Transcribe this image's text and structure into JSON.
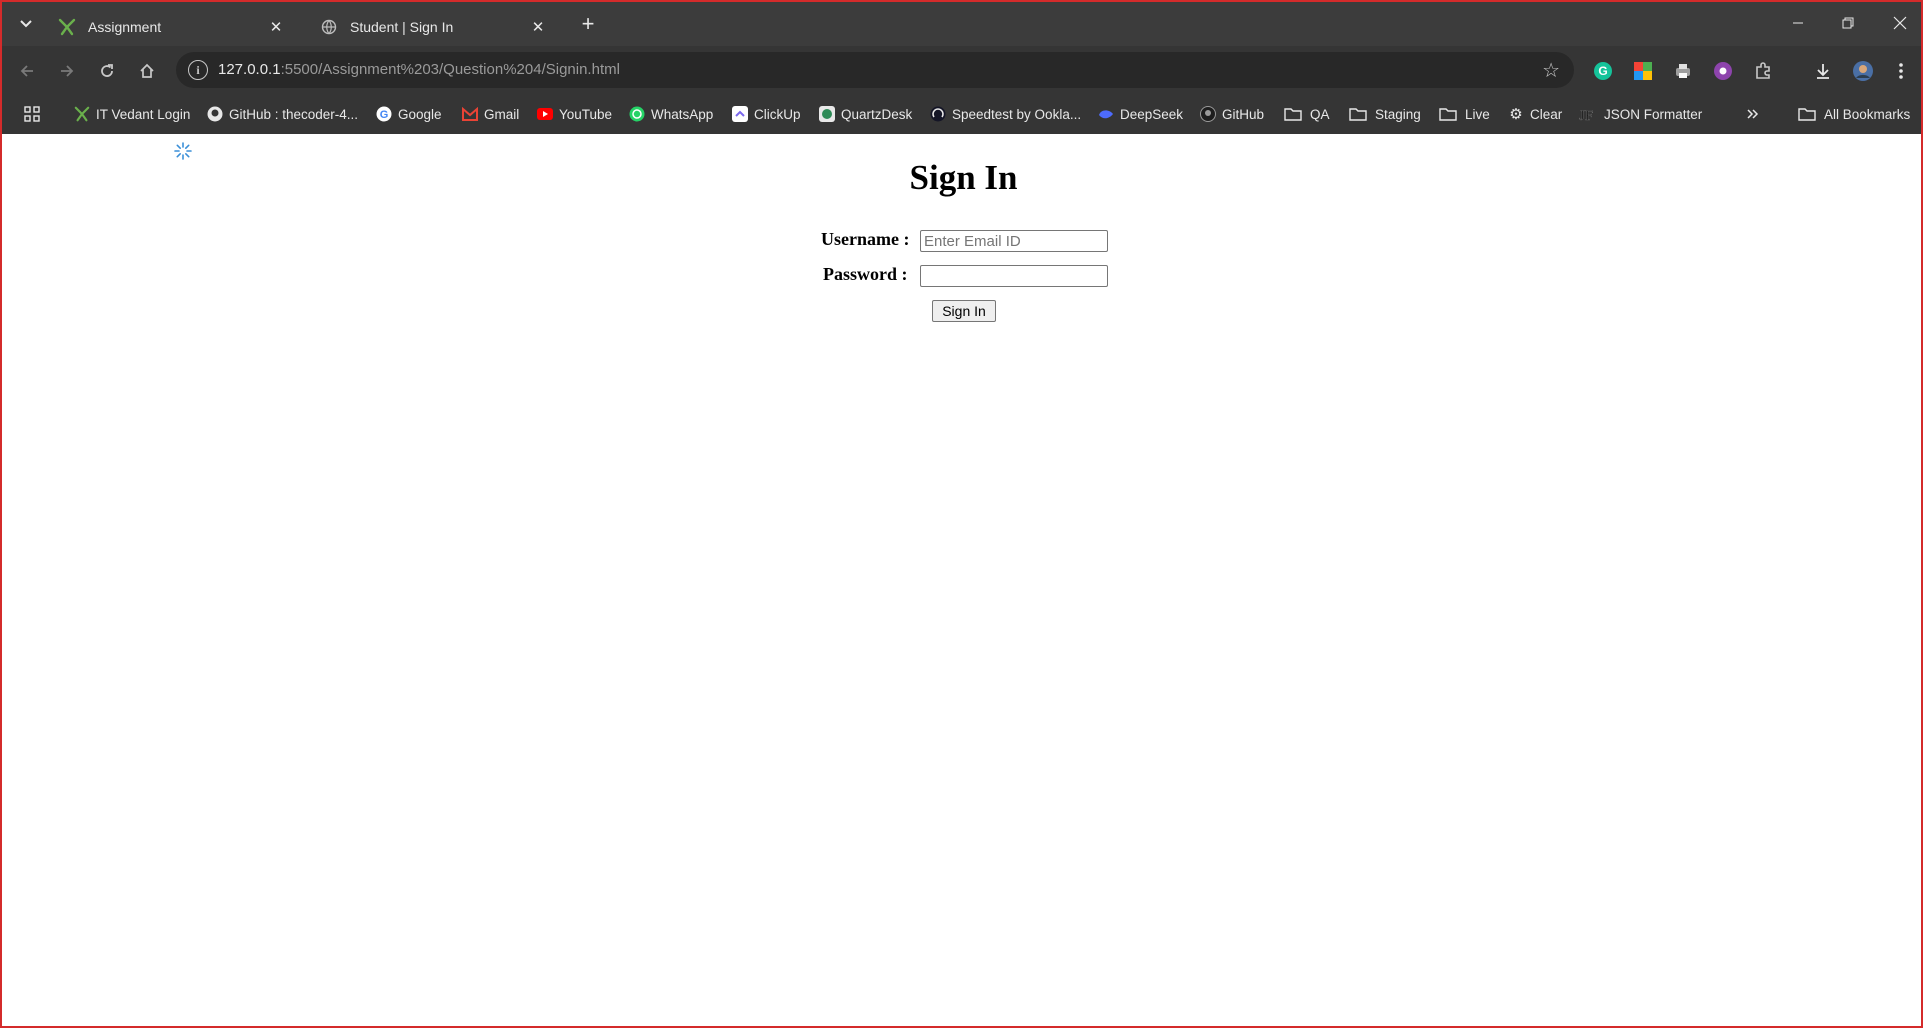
{
  "browser": {
    "tabs": [
      {
        "title": "Assignment",
        "icon": "itvedant-favicon",
        "active": true
      },
      {
        "title": "Student | Sign In",
        "icon": "globe-icon",
        "active": false
      }
    ],
    "address": {
      "host": "127.0.0.1",
      "path": ":5500/Assignment%203/Question%204/Signin.html"
    },
    "bookmarks": [
      {
        "label": "IT Vedant Login",
        "icon": "itvedant-icon",
        "color": "#6ab04c"
      },
      {
        "label": "GitHub : thecoder-4...",
        "icon": "github-icon",
        "color": "#e8e8e8"
      },
      {
        "label": "Google",
        "icon": "google-icon",
        "color": "#4285f4"
      },
      {
        "label": "Gmail",
        "icon": "gmail-icon",
        "color": "#ea4335"
      },
      {
        "label": "YouTube",
        "icon": "youtube-icon",
        "color": "#ff0000"
      },
      {
        "label": "WhatsApp",
        "icon": "whatsapp-icon",
        "color": "#25d366"
      },
      {
        "label": "ClickUp",
        "icon": "clickup-icon",
        "color": "#7b68ee"
      },
      {
        "label": "QuartzDesk",
        "icon": "quartzdesk-icon",
        "color": "#2e8b57"
      },
      {
        "label": "Speedtest by Ookla...",
        "icon": "speedtest-icon",
        "color": "#e8e8e8"
      },
      {
        "label": "DeepSeek",
        "icon": "deepseek-icon",
        "color": "#4d6bfe"
      },
      {
        "label": "GitHub",
        "icon": "github-icon",
        "color": "#e8e8e8"
      },
      {
        "label": "QA",
        "icon": "folder-icon",
        "color": "#e8e8e8"
      },
      {
        "label": "Staging",
        "icon": "folder-icon",
        "color": "#e8e8e8"
      },
      {
        "label": "Live",
        "icon": "folder-icon",
        "color": "#e8e8e8"
      },
      {
        "label": "Clear",
        "icon": "gear-icon",
        "color": "#e8e8e8"
      },
      {
        "label": "JSON Formatter",
        "icon": "json-formatter-icon",
        "color": "#e8e8e8"
      }
    ],
    "all_bookmarks_label": "All Bookmarks",
    "frame_color": "#d42b2b"
  },
  "page": {
    "title": "Sign In",
    "username_label": "Username :",
    "username_placeholder": "Enter Email ID",
    "username_value": "",
    "password_label": "Password :",
    "password_value": "",
    "submit_label": "Sign In"
  }
}
